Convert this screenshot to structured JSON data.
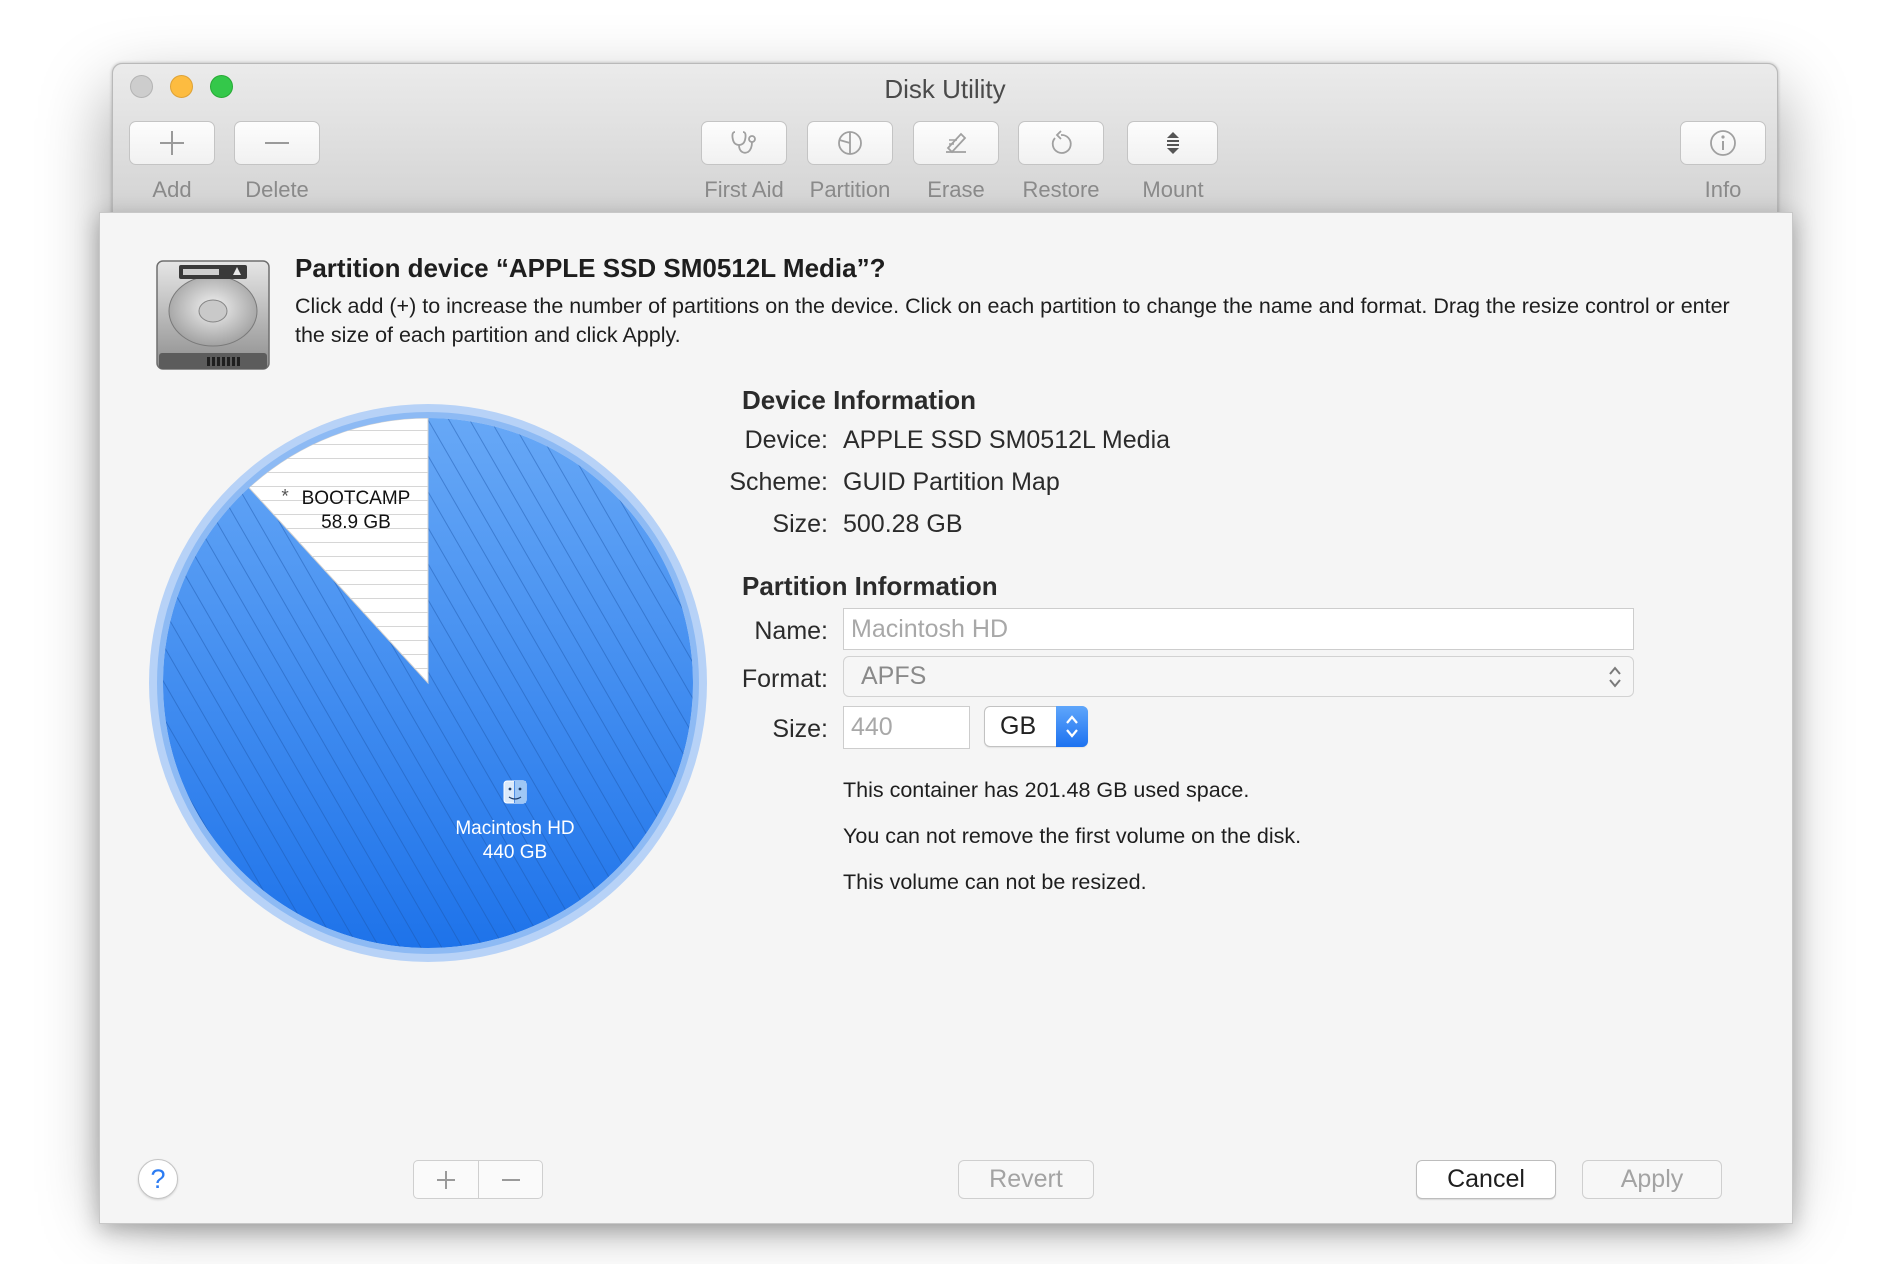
{
  "window": {
    "title": "Disk Utility"
  },
  "toolbar": {
    "add_label": "Add",
    "delete_label": "Delete",
    "first_aid_label": "First Aid",
    "partition_label": "Partition",
    "erase_label": "Erase",
    "restore_label": "Restore",
    "mount_label": "Mount",
    "info_label": "Info"
  },
  "sheet": {
    "title": "Partition device “APPLE SSD SM0512L Media”?",
    "description": "Click add (+) to increase the number of partitions on the device. Click on each partition to change the name and format. Drag the resize control or enter the size of each partition and click Apply."
  },
  "pie": {
    "partitions": [
      {
        "name": "BOOTCAMP",
        "size": "58.9 GB",
        "size_gb": 58.9,
        "selected": false
      },
      {
        "name": "Macintosh HD",
        "size": "440 GB",
        "size_gb": 440,
        "selected": true
      }
    ],
    "marker": "*",
    "colors": {
      "selected_fill": "#3a8cf0",
      "unselected_fill": "#ffffff"
    }
  },
  "device_info": {
    "heading": "Device Information",
    "device_label": "Device:",
    "device_value": "APPLE SSD SM0512L Media",
    "scheme_label": "Scheme:",
    "scheme_value": "GUID Partition Map",
    "size_label": "Size:",
    "size_value": "500.28 GB"
  },
  "partition_info": {
    "heading": "Partition Information",
    "name_label": "Name:",
    "name_placeholder": "Macintosh HD",
    "format_label": "Format:",
    "format_value": "APFS",
    "size_label": "Size:",
    "size_value": "440",
    "unit_value": "GB",
    "notes": [
      "This container has 201.48 GB used space.",
      "You can not remove the first volume on the disk.",
      "This volume can not be resized."
    ]
  },
  "buttons": {
    "help": "?",
    "revert": "Revert",
    "cancel": "Cancel",
    "apply": "Apply"
  },
  "icons": {
    "add": "plus-icon",
    "delete": "minus-icon",
    "first_aid": "stethoscope-icon",
    "partition": "partition-icon",
    "erase": "erase-icon",
    "restore": "restore-icon",
    "mount": "mount-icon",
    "info": "info-icon",
    "disk": "hard-drive-icon",
    "finder": "finder-icon"
  }
}
